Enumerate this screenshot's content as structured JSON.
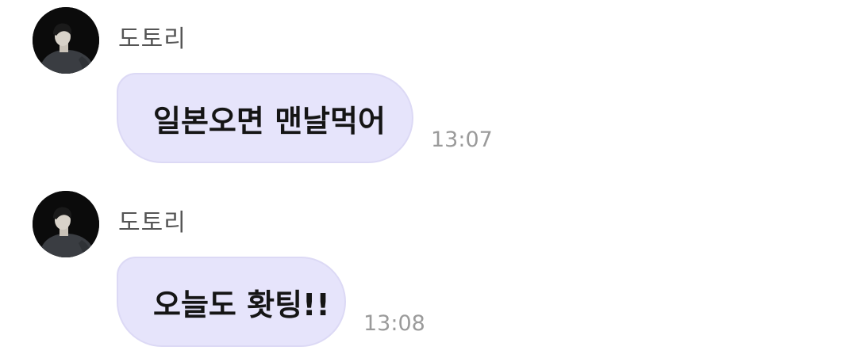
{
  "messages": [
    {
      "sender": "도토리",
      "text": "일본오면 맨날먹어",
      "time": "13:07",
      "avatar_icon": "profile-photo"
    },
    {
      "sender": "도토리",
      "text": "오늘도 홧팅!!",
      "time": "13:08",
      "avatar_icon": "profile-photo"
    }
  ],
  "colors": {
    "bubble": "#e6e4fb",
    "bubble_border": "#dcd9f5",
    "sender": "#555555",
    "time": "#9a9a9a",
    "message_text": "#151515"
  }
}
